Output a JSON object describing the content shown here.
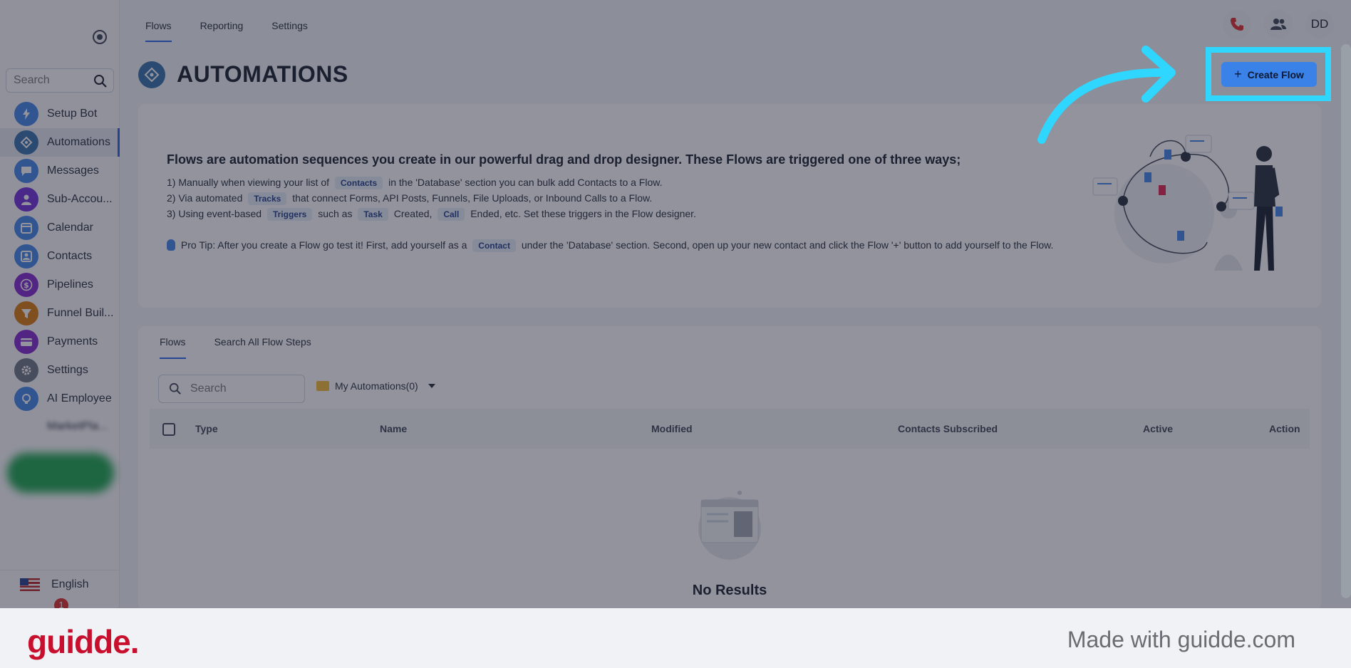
{
  "top_tabs": [
    "Flows",
    "Reporting",
    "Settings"
  ],
  "header": {
    "avatar_initials": "DD"
  },
  "sidebar": {
    "search_placeholder": "Search",
    "items": [
      {
        "label": "Setup Bot",
        "icon": "lightning-icon",
        "color": "#3b82e8"
      },
      {
        "label": "Automations",
        "icon": "automation-icon",
        "color": "#2f6ca8"
      },
      {
        "label": "Messages",
        "icon": "chat-icon",
        "color": "#3b82e8"
      },
      {
        "label": "Sub-Accou...",
        "icon": "user-icon",
        "color": "#6d28d9"
      },
      {
        "label": "Calendar",
        "icon": "calendar-icon",
        "color": "#3b82e8"
      },
      {
        "label": "Contacts",
        "icon": "contacts-icon",
        "color": "#3b82e8"
      },
      {
        "label": "Pipelines",
        "icon": "dollar-icon",
        "color": "#7e22ce"
      },
      {
        "label": "Funnel Buil...",
        "icon": "funnel-icon",
        "color": "#d97706"
      },
      {
        "label": "Payments",
        "icon": "card-icon",
        "color": "#7e22ce"
      },
      {
        "label": "Settings",
        "icon": "gear-icon",
        "color": "#6b7280"
      },
      {
        "label": "AI Employee",
        "icon": "ai-icon",
        "color": "#3b82e8"
      }
    ],
    "blurred_label": "MarketPla...",
    "language": "English",
    "notification_count": "1"
  },
  "page": {
    "title": "AUTOMATIONS",
    "create_button": "Create Flow"
  },
  "info": {
    "heading": "Flows are automation sequences you create in our powerful drag and drop designer. These Flows are triggered one of three ways;",
    "line1": {
      "pre": "1) Manually when viewing your list of",
      "chip": "Contacts",
      "post": "in the 'Database' section you can bulk add Contacts to a Flow."
    },
    "line2": {
      "pre": "2) Via automated",
      "chip": "Tracks",
      "post": "that connect Forms, API Posts, Funnels, File Uploads, or Inbound Calls to a Flow."
    },
    "line3": {
      "pre": "3) Using event-based",
      "chip1": "Triggers",
      "mid1": "such as",
      "chip2": "Task",
      "mid2": "Created,",
      "chip3": "Call",
      "post": "Ended, etc. Set these triggers in the Flow designer."
    },
    "tip": {
      "pre": "Pro Tip: After you create a Flow go test it! First, add yourself as a",
      "chip": "Contact",
      "post": "under the 'Database' section. Second, open up your new contact and click the Flow '+' button to add yourself to the Flow."
    }
  },
  "flows": {
    "tabs": [
      "Flows",
      "Search All Flow Steps"
    ],
    "search_placeholder": "Search",
    "folder_label": "My Automations(0)",
    "columns": [
      "Type",
      "Name",
      "Modified",
      "Contacts Subscribed",
      "Active",
      "Action"
    ],
    "empty_text": "No Results"
  },
  "footer": {
    "brand": "guidde.",
    "made_with": "Made with guidde.com"
  },
  "colors": {
    "accent": "#3b82e8",
    "highlight": "#2fd6ff",
    "brand": "#c8102e"
  }
}
